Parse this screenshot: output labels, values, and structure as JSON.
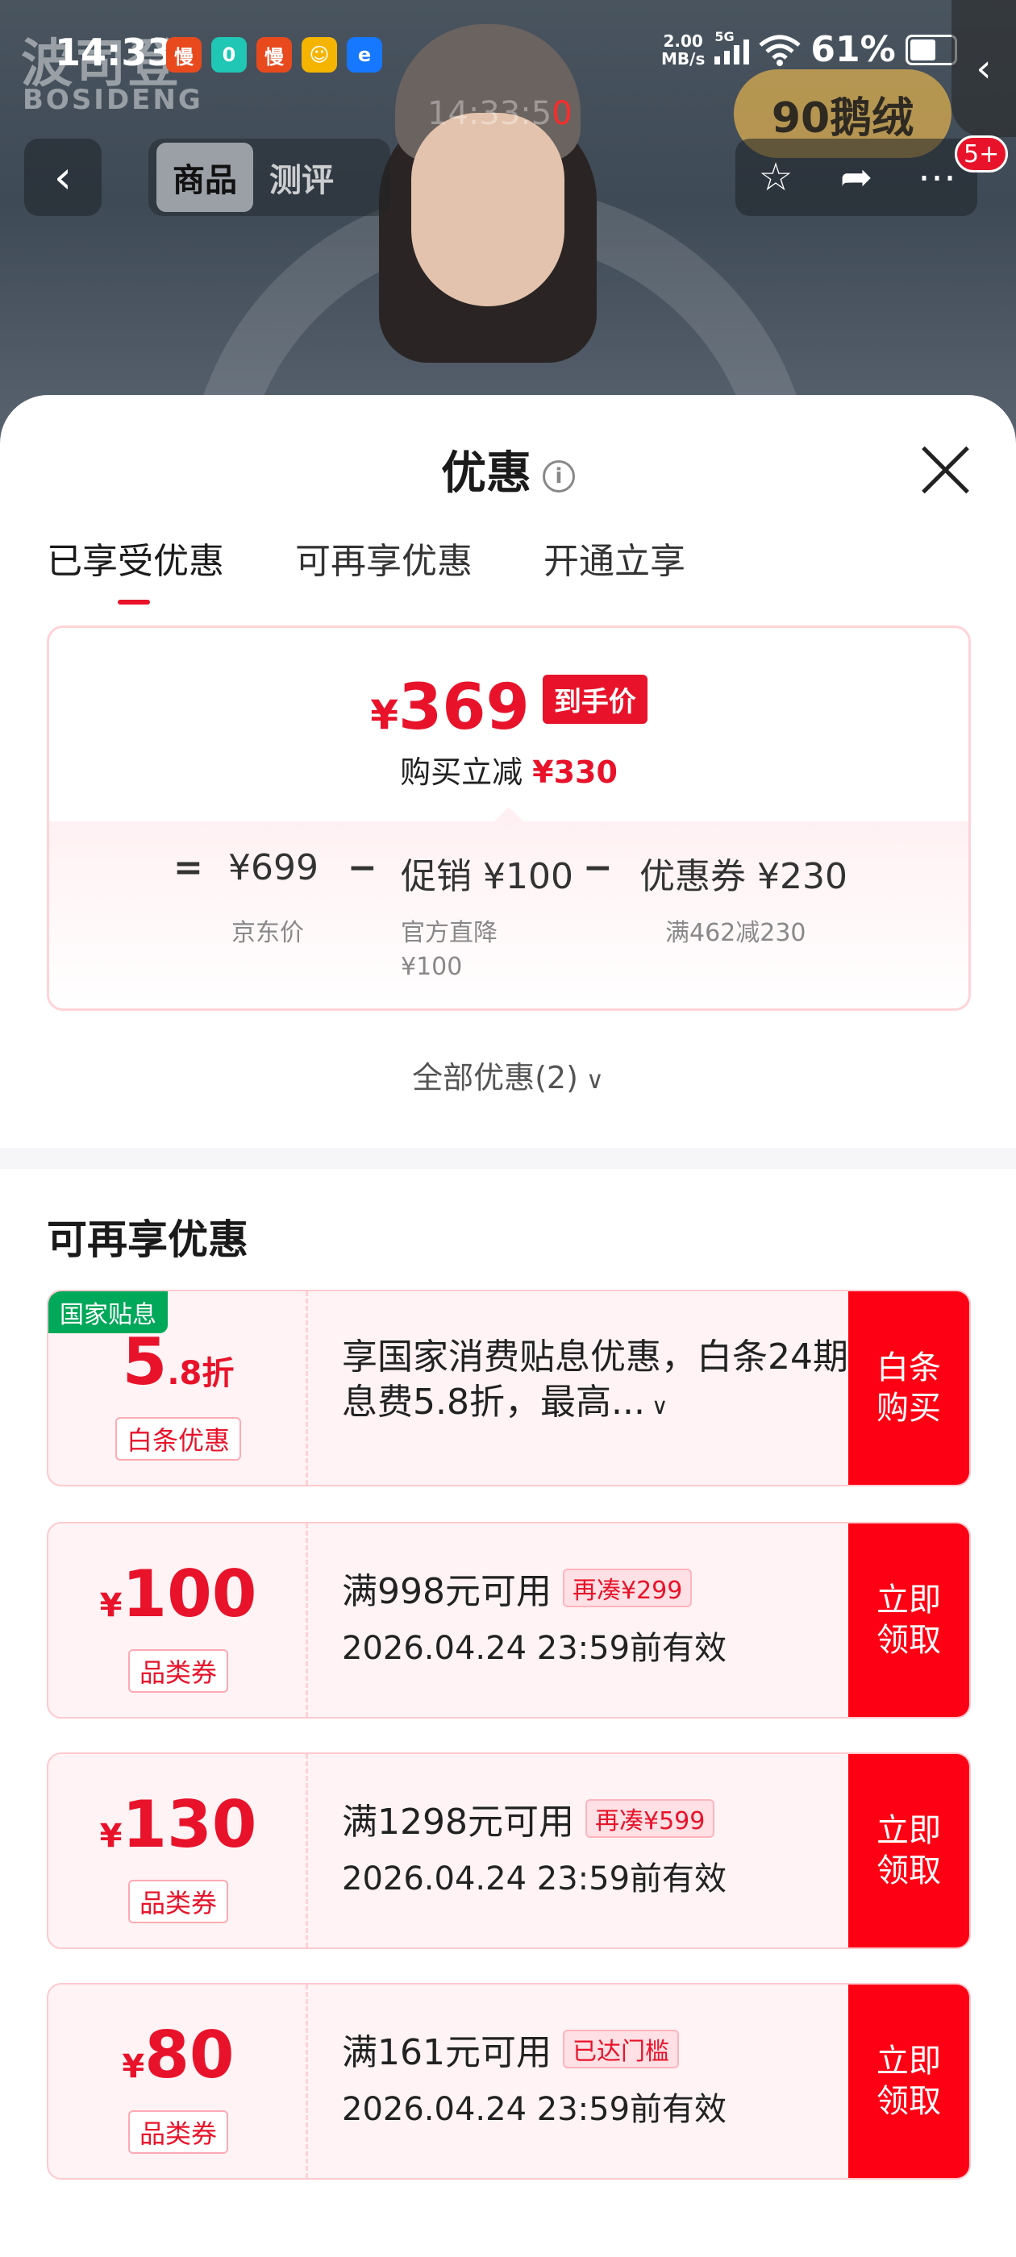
{
  "status_bar": {
    "time": "14:33",
    "app_icons": [
      "慢",
      "0",
      "慢",
      "☺",
      "e"
    ],
    "net_speed_value": "2.00",
    "net_speed_unit": "MB/s",
    "network": "5G",
    "battery": "61%",
    "battery_level": 0.61
  },
  "background": {
    "brand_cn": "波司登",
    "brand_en": "BOSIDENG",
    "ghost_time": "14:33:5",
    "ghost_red": "0",
    "badge": "90鹅绒"
  },
  "nav": {
    "tabs": [
      "商品",
      "测评"
    ],
    "notification_badge": "5+"
  },
  "sheet": {
    "title": "优惠",
    "info_icon": "i",
    "tabs": [
      "已享受优惠",
      "可再享优惠",
      "开通立享"
    ],
    "price_card": {
      "currency": "¥",
      "final_price": "369",
      "final_tag": "到手价",
      "saving_label": "购买立减",
      "saving_value": "¥330",
      "equals": "=",
      "minus": "−",
      "jd_price": "¥699",
      "jd_price_label": "京东价",
      "promo": "促销 ¥100",
      "promo_label": "官方直降",
      "promo_label_value": "¥100",
      "coupon": "优惠券 ¥230",
      "coupon_label": "满462减230"
    },
    "all_promos": "全部优惠(2)",
    "section_title": "可再享优惠",
    "coupons": [
      {
        "tag": "国家贴息",
        "amount_big": "5",
        "amount_small": ".8折",
        "type": "白条优惠",
        "description": "享国家消费贴息优惠，白条24期息费5.8折，最高...",
        "cta": "白条购买"
      },
      {
        "amount_prefix": "¥",
        "amount_big": "100",
        "type": "品类券",
        "condition": "满998元可用",
        "pill": "再凑¥299",
        "validity": "2026.04.24 23:59前有效",
        "cta": "立即领取"
      },
      {
        "amount_prefix": "¥",
        "amount_big": "130",
        "type": "品类券",
        "condition": "满1298元可用",
        "pill": "再凑¥599",
        "validity": "2026.04.24 23:59前有效",
        "cta": "立即领取"
      },
      {
        "amount_prefix": "¥",
        "amount_big": "80",
        "type": "品类券",
        "condition": "满161元可用",
        "pill": "已达门槛",
        "validity": "2026.04.24 23:59前有效",
        "cta": "立即领取"
      }
    ]
  },
  "colors": {
    "accent_red": "#e8132a",
    "cta_red": "#fe0014",
    "gov_green": "#00a85a"
  }
}
